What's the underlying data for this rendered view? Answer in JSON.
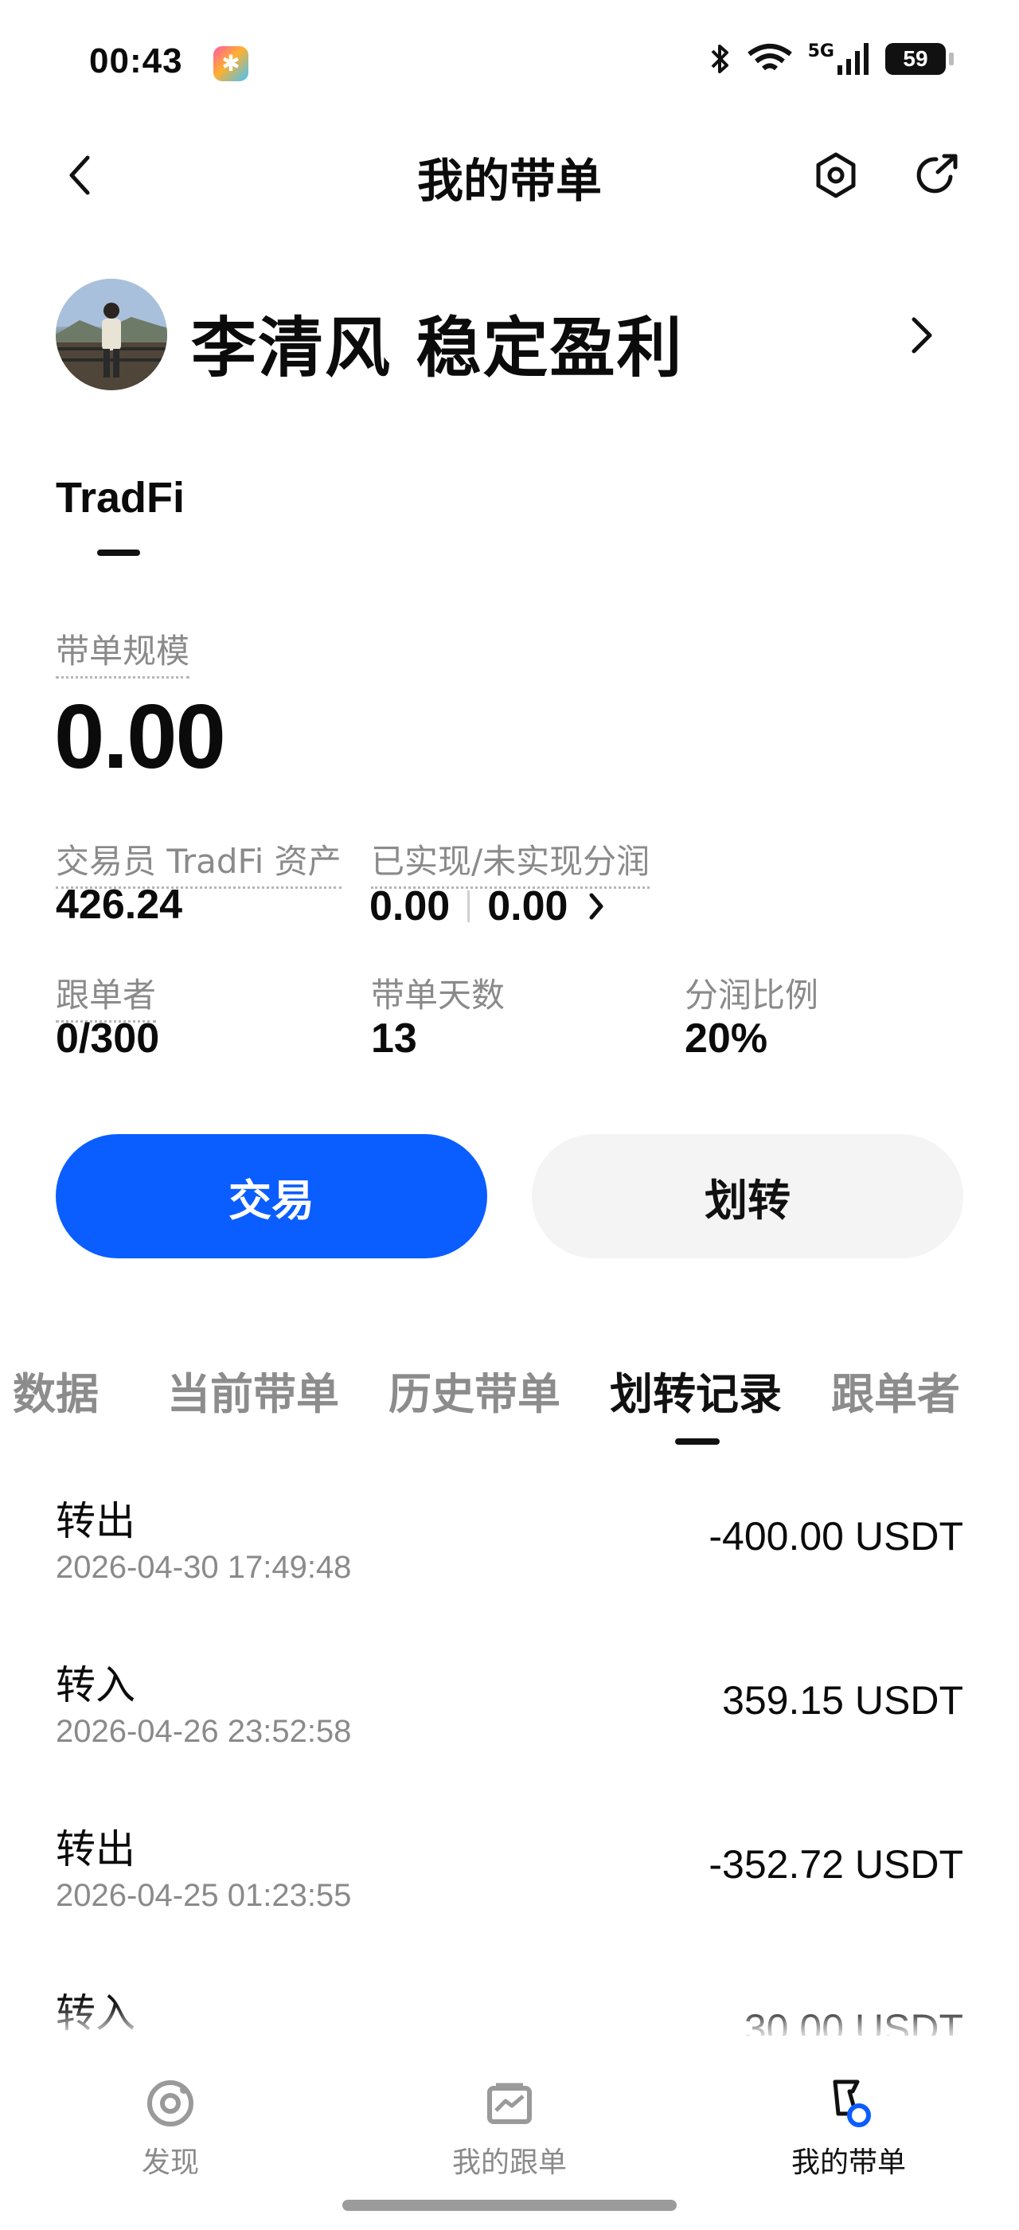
{
  "status_bar": {
    "time": "00:43",
    "network": "5G",
    "battery": "59"
  },
  "header": {
    "title": "我的带单"
  },
  "profile": {
    "name": "李清风 稳定盈利"
  },
  "account_tab": "TradFi",
  "stats": {
    "scale_label": "带单规模",
    "scale_value": "0.00",
    "trader_assets_label": "交易员 TradFi 资产",
    "trader_assets_value": "426.24",
    "profit_label": "已实现/未实现分润",
    "realized": "0.00",
    "unrealized": "0.00",
    "followers_label": "跟单者",
    "followers_value": "0/300",
    "days_label": "带单天数",
    "days_value": "13",
    "share_label": "分润比例",
    "share_value": "20%"
  },
  "actions": {
    "trade_label": "交易",
    "transfer_label": "划转"
  },
  "tabs": [
    {
      "label": "数据"
    },
    {
      "label": "当前带单"
    },
    {
      "label": "历史带单"
    },
    {
      "label": "划转记录"
    },
    {
      "label": "跟单者"
    }
  ],
  "records": [
    {
      "type": "转出",
      "date": "2026-04-30 17:49:48",
      "amount": "-400.00 USDT"
    },
    {
      "type": "转入",
      "date": "2026-04-26 23:52:58",
      "amount": "359.15 USDT"
    },
    {
      "type": "转出",
      "date": "2026-04-25 01:23:55",
      "amount": "-352.72 USDT"
    },
    {
      "type": "转入",
      "date": "",
      "amount": "30.00 USDT"
    }
  ],
  "bottom_nav": [
    {
      "label": "发现"
    },
    {
      "label": "我的跟单"
    },
    {
      "label": "我的带单"
    }
  ],
  "colors": {
    "primary": "#0a5dff",
    "text": "#0b0b0b",
    "muted": "#8a8a8a"
  }
}
